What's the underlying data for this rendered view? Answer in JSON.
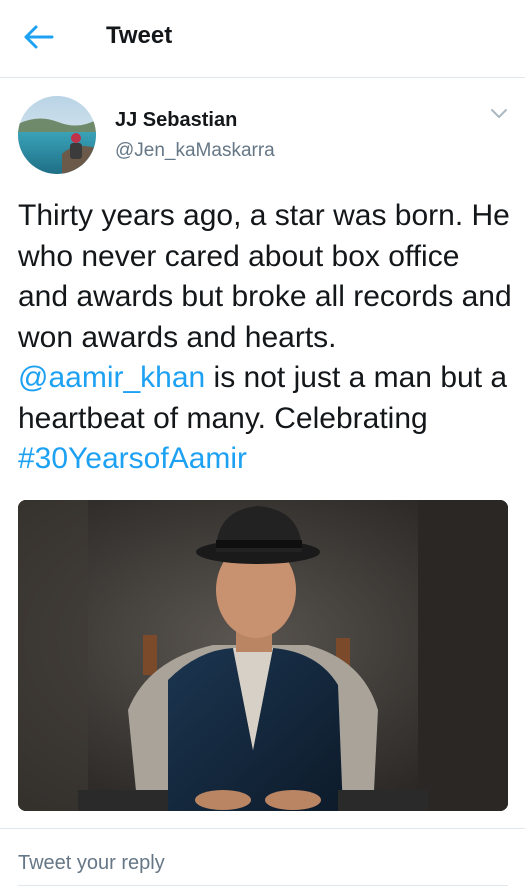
{
  "header": {
    "title": "Tweet",
    "back_icon": "back-arrow-icon",
    "accent_color": "#1da1f2"
  },
  "author": {
    "name": "JJ Sebastian",
    "handle": "@Jen_kaMaskarra"
  },
  "tweet": {
    "text_line1_a": "Thirty years ago, a star was born. He who never cared about box office and awards but broke all records and won awards and hearts. ",
    "mention": "@aamir_khan",
    "text_line1_b": " is not just a man but a heartbeat of many. Celebrating ",
    "hashtag": "#30YearsofAamir"
  },
  "reply": {
    "placeholder": "Tweet your reply"
  }
}
